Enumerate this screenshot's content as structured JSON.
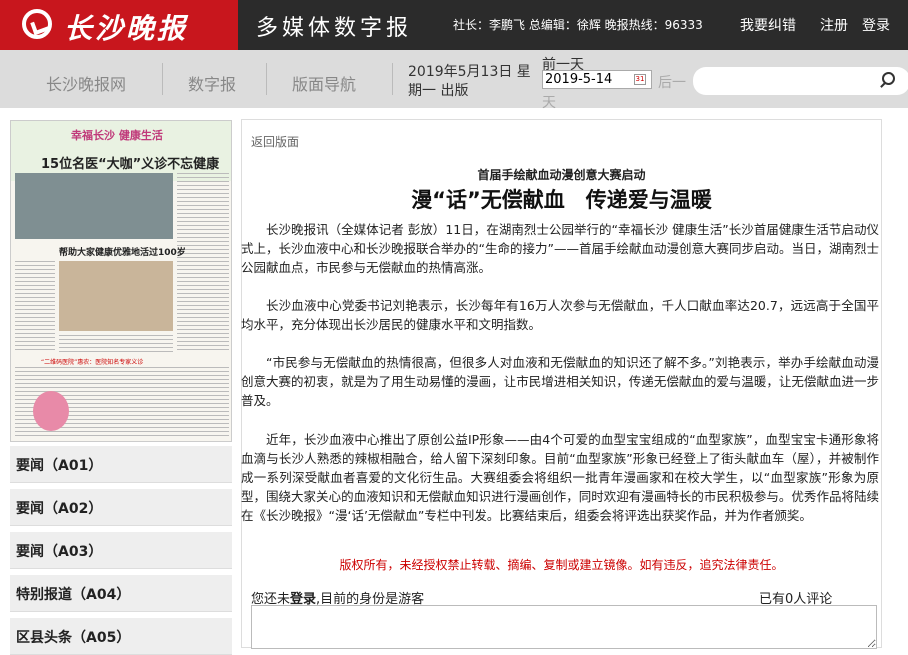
{
  "header": {
    "logo_text": "长沙晚报",
    "site_title": "多媒体数字报",
    "editor_info": "社长：李鹏飞 总编辑：徐辉 晚报热线：96333",
    "links": [
      "我要纠错",
      "注册",
      "登录"
    ]
  },
  "nav": {
    "items": [
      "长沙晚报网",
      "数字报",
      "版面导航"
    ],
    "date_text": "2019年5月13日 星期一 出版",
    "prev_day": "前一天",
    "date_value": "2019-5-14",
    "next_day_a": "后一",
    "next_day_b": "天",
    "search_placeholder": ""
  },
  "thumbnail": {
    "banner": "幸福长沙 健康生活",
    "headline": "15位名医“大咖”义诊不忘健康科普",
    "headline2": "帮助大家健康优雅地活过100岁",
    "headline3": "“二维码医院”惠农：医院知名专家义诊"
  },
  "sections": [
    "要闻（A01）",
    "要闻（A02）",
    "要闻（A03）",
    "特别报道（A04）",
    "区县头条（A05）"
  ],
  "article": {
    "back_label": "返回版面",
    "subtitle": "首届手绘献血动漫创意大赛启动",
    "headline": "漫“话”无偿献血　传递爱与温暖",
    "paragraphs": [
      "长沙晚报讯（全媒体记者 彭放）11日，在湖南烈士公园举行的“幸福长沙 健康生活”长沙首届健康生活节启动仪式上，长沙血液中心和长沙晚报联合举办的“生命的接力”——首届手绘献血动漫创意大赛同步启动。当日，湖南烈士公园献血点，市民参与无偿献血的热情高涨。",
      "长沙血液中心党委书记刘艳表示，长沙每年有16万人次参与无偿献血，千人口献血率达20.7，远远高于全国平均水平，充分体现出长沙居民的健康水平和文明指数。",
      "“市民参与无偿献血的热情很高，但很多人对血液和无偿献血的知识还了解不多。”刘艳表示，举办手绘献血动漫创意大赛的初衷，就是为了用生动易懂的漫画，让市民增进相关知识，传递无偿献血的爱与温暖，让无偿献血进一步普及。",
      "近年，长沙血液中心推出了原创公益IP形象——由4个可爱的血型宝宝组成的“血型家族”，血型宝宝卡通形象将血滴与长沙人熟悉的辣椒相融合，给人留下深刻印象。目前“血型家族”形象已经登上了街头献血车（屋），并被制作成一系列深受献血者喜爱的文化衍生品。大赛组委会将组织一批青年漫画家和在校大学生，以“血型家族”形象为原型，围绕大家关心的血液知识和无偿献血知识进行漫画创作，同时欢迎有漫画特长的市民积极参与。优秀作品将陆续在《长沙晚报》“漫‘话’无偿献血”专栏中刊发。比赛结束后，组委会将评选出获奖作品，并为作者颁奖。"
    ],
    "copyright": "版权所有，未经授权禁止转载、摘编、复制或建立镜像。如有违反，追究法律责任。"
  },
  "comments": {
    "prefix": "您还未",
    "login": "登录",
    "suffix": ",目前的身份是游客",
    "count_text": "已有0人评论"
  }
}
